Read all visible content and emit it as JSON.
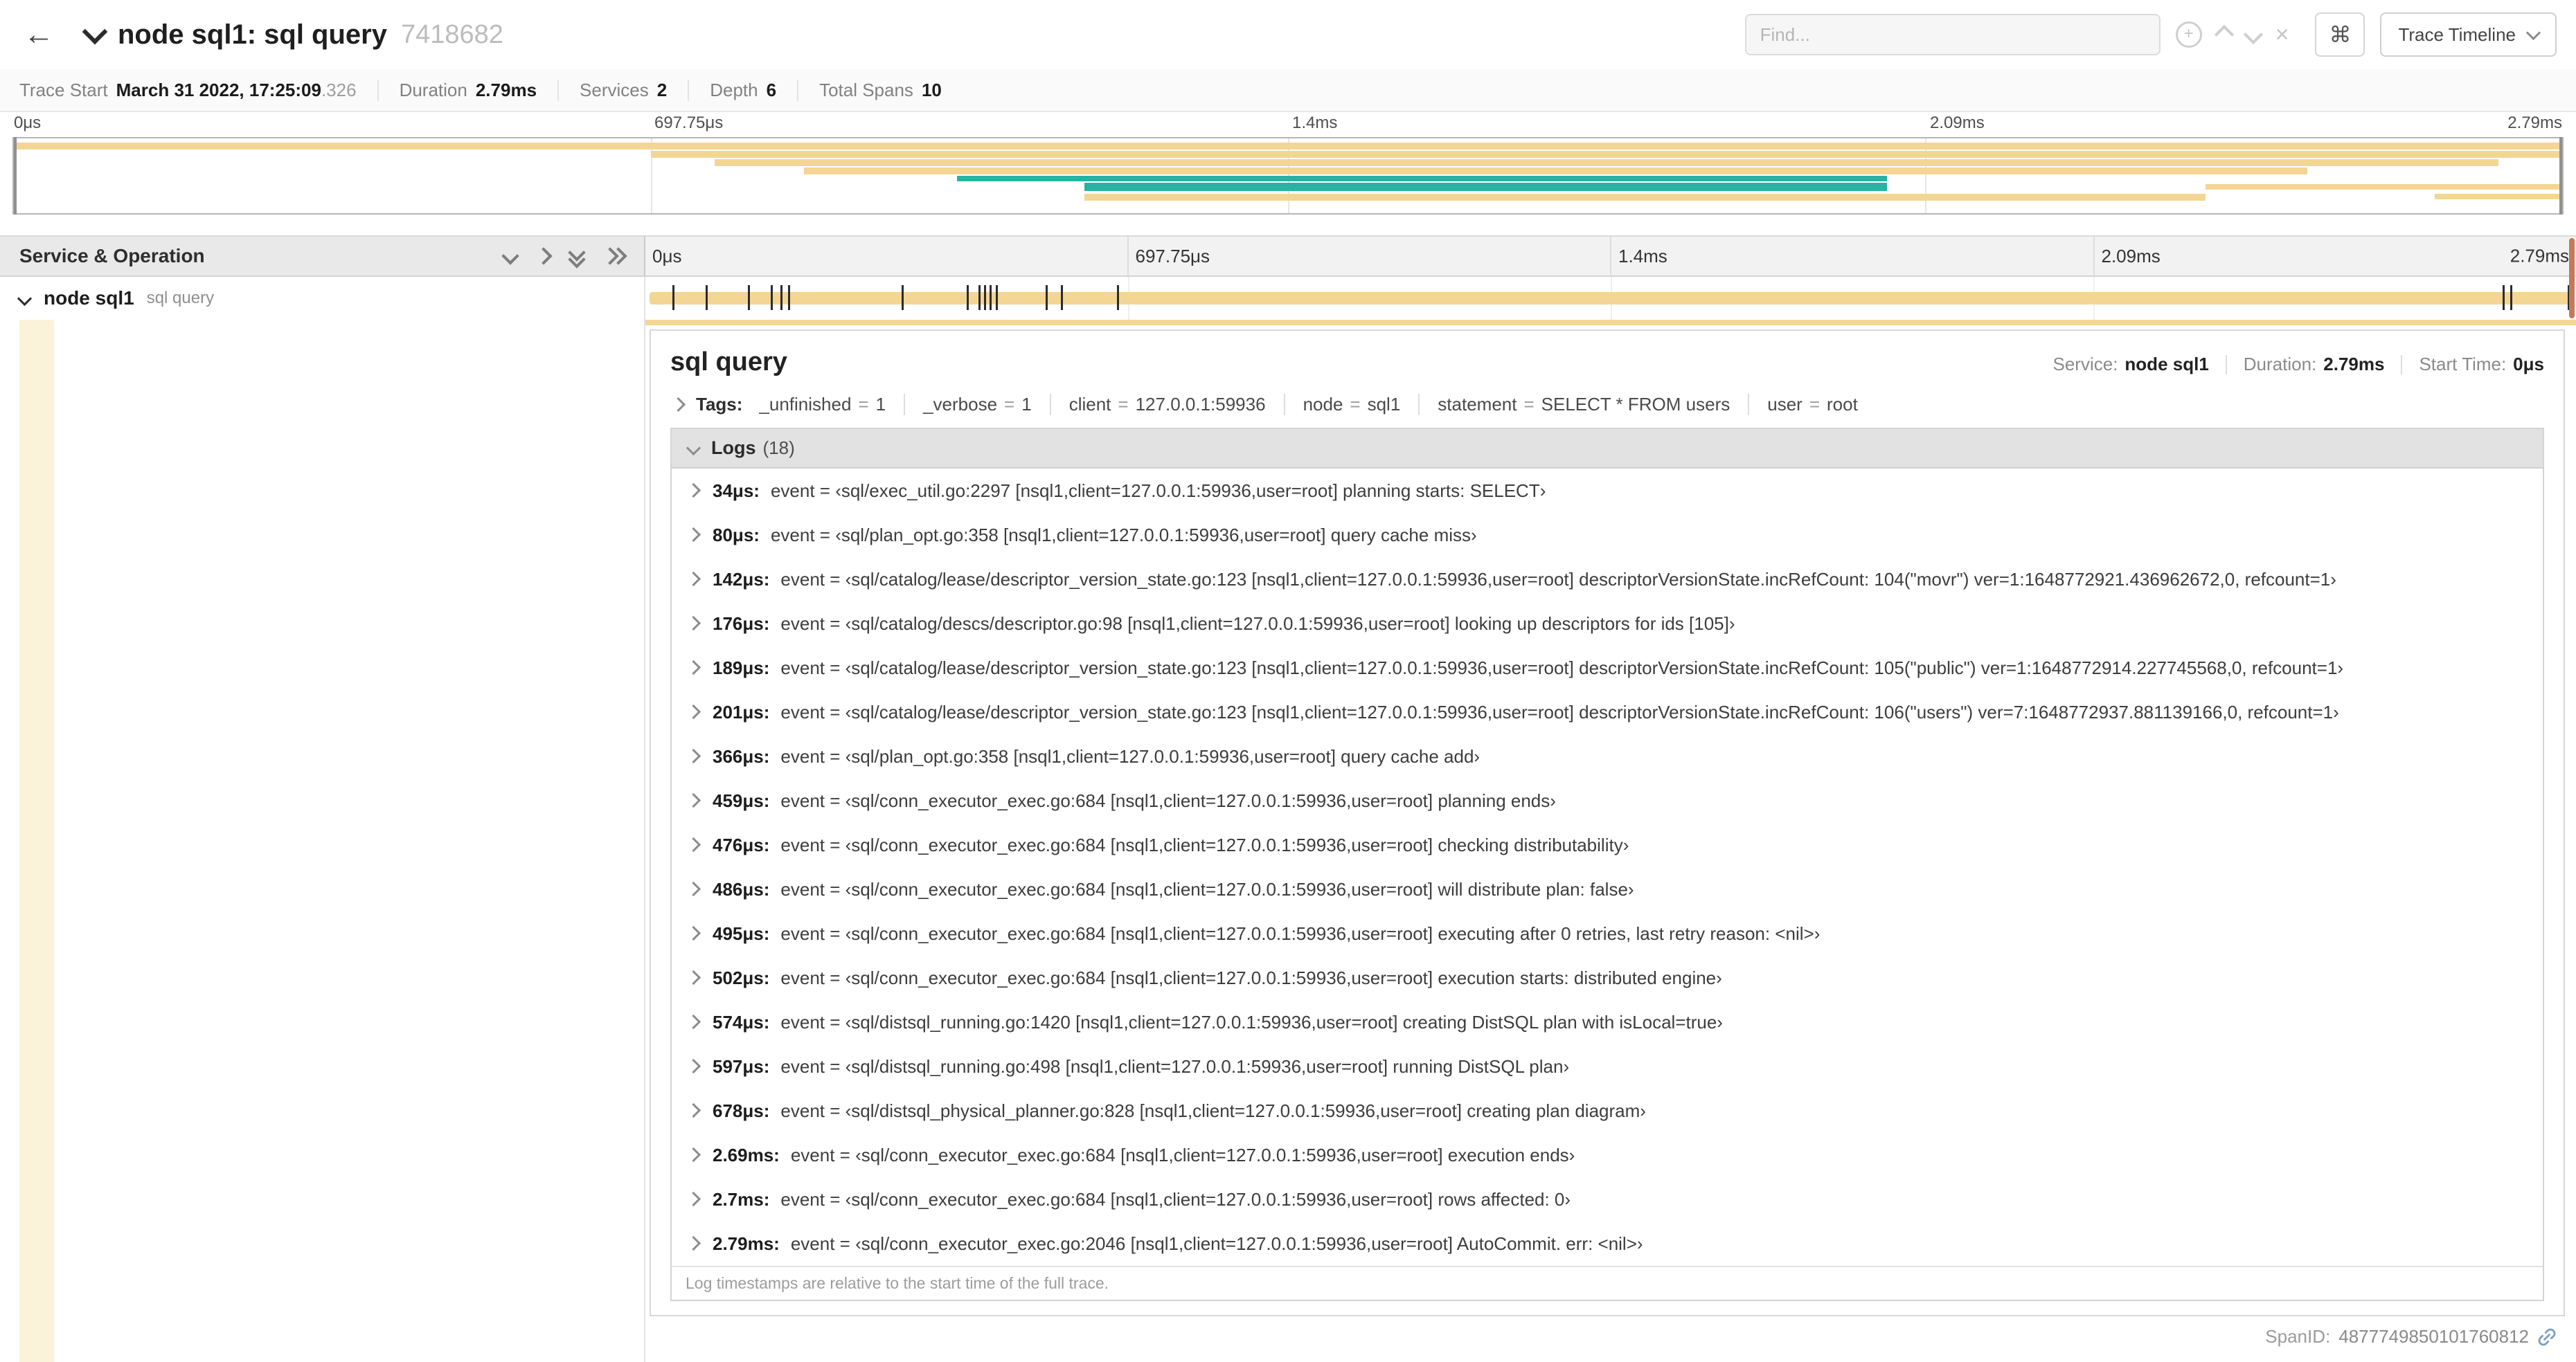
{
  "icons": {
    "back": "←",
    "command": "⌘",
    "clear": "×",
    "plus": "+"
  },
  "colors": {
    "tan": "#f3d694",
    "teal": "#26b3a4",
    "cream": "#fbf2da",
    "tick": "#2b2b2b"
  },
  "header": {
    "title": "node sql1: sql query",
    "trace_id": "7418682",
    "find_placeholder": "Find...",
    "view_button": "Trace Timeline"
  },
  "summary": {
    "items": [
      {
        "label": "Trace Start",
        "value": "March 31 2022, 17:25:09",
        "extra": ".326"
      },
      {
        "label": "Duration",
        "value": "2.79ms"
      },
      {
        "label": "Services",
        "value": "2"
      },
      {
        "label": "Depth",
        "value": "6"
      },
      {
        "label": "Total Spans",
        "value": "10"
      }
    ]
  },
  "axis": {
    "ticks": [
      "0μs",
      "697.75μs",
      "1.4ms",
      "2.09ms",
      "2.79ms"
    ]
  },
  "minimap": {
    "bars": [
      {
        "l": 0,
        "w": 100,
        "t": 3,
        "h": 5,
        "c": "tan"
      },
      {
        "l": 25,
        "w": 75,
        "t": 9,
        "h": 5,
        "c": "tan"
      },
      {
        "l": 27.5,
        "w": 70,
        "t": 15,
        "h": 5,
        "c": "tan"
      },
      {
        "l": 31,
        "w": 59,
        "t": 21,
        "h": 5,
        "c": "tan"
      },
      {
        "l": 37,
        "w": 36.5,
        "t": 27,
        "h": 4,
        "c": "teal"
      },
      {
        "l": 42,
        "w": 31.5,
        "t": 32,
        "h": 6,
        "c": "teal"
      },
      {
        "l": 42,
        "w": 44,
        "t": 40,
        "h": 5,
        "c": "tan"
      },
      {
        "l": 86,
        "w": 14,
        "t": 33,
        "h": 4,
        "c": "tan"
      },
      {
        "l": 95,
        "w": 5,
        "t": 40,
        "h": 4,
        "c": "tan"
      }
    ]
  },
  "timeline": {
    "left_header": "Service & Operation",
    "span": {
      "service": "node sql1",
      "operation": "sql query",
      "tick_percents": [
        1.2,
        2.9,
        5.1,
        6.3,
        6.8,
        7.2,
        13.1,
        16.5,
        17.1,
        17.4,
        17.7,
        18.0,
        20.6,
        21.4,
        24.3,
        96.4,
        96.8,
        99.8
      ]
    }
  },
  "detail": {
    "title": "sql query",
    "service_label": "Service:",
    "service": "node sql1",
    "duration_label": "Duration:",
    "duration": "2.79ms",
    "start_label": "Start Time:",
    "start": "0μs",
    "tags_label": "Tags:",
    "tags_eq": "=",
    "tags": [
      {
        "k": "_unfinished",
        "v": "1"
      },
      {
        "k": "_verbose",
        "v": "1"
      },
      {
        "k": "client",
        "v": "127.0.0.1:59936"
      },
      {
        "k": "node",
        "v": "sql1"
      },
      {
        "k": "statement",
        "v": "SELECT * FROM users"
      },
      {
        "k": "user",
        "v": "root"
      }
    ],
    "logs_label": "Logs",
    "logs_count": "(18)",
    "logs": [
      {
        "t": "34μs:",
        "msg": "event = ‹sql/exec_util.go:2297 [nsql1,client=127.0.0.1:59936,user=root] planning starts: SELECT›"
      },
      {
        "t": "80μs:",
        "msg": "event = ‹sql/plan_opt.go:358 [nsql1,client=127.0.0.1:59936,user=root] query cache miss›"
      },
      {
        "t": "142μs:",
        "msg": "event = ‹sql/catalog/lease/descriptor_version_state.go:123 [nsql1,client=127.0.0.1:59936,user=root] descriptorVersionState.incRefCount: 104(\"movr\") ver=1:1648772921.436962672,0, refcount=1›"
      },
      {
        "t": "176μs:",
        "msg": "event = ‹sql/catalog/descs/descriptor.go:98 [nsql1,client=127.0.0.1:59936,user=root] looking up descriptors for ids [105]›"
      },
      {
        "t": "189μs:",
        "msg": "event = ‹sql/catalog/lease/descriptor_version_state.go:123 [nsql1,client=127.0.0.1:59936,user=root] descriptorVersionState.incRefCount: 105(\"public\") ver=1:1648772914.227745568,0, refcount=1›"
      },
      {
        "t": "201μs:",
        "msg": "event = ‹sql/catalog/lease/descriptor_version_state.go:123 [nsql1,client=127.0.0.1:59936,user=root] descriptorVersionState.incRefCount: 106(\"users\") ver=7:1648772937.881139166,0, refcount=1›"
      },
      {
        "t": "366μs:",
        "msg": "event = ‹sql/plan_opt.go:358 [nsql1,client=127.0.0.1:59936,user=root] query cache add›"
      },
      {
        "t": "459μs:",
        "msg": "event = ‹sql/conn_executor_exec.go:684 [nsql1,client=127.0.0.1:59936,user=root] planning ends›"
      },
      {
        "t": "476μs:",
        "msg": "event = ‹sql/conn_executor_exec.go:684 [nsql1,client=127.0.0.1:59936,user=root] checking distributability›"
      },
      {
        "t": "486μs:",
        "msg": "event = ‹sql/conn_executor_exec.go:684 [nsql1,client=127.0.0.1:59936,user=root] will distribute plan: false›"
      },
      {
        "t": "495μs:",
        "msg": "event = ‹sql/conn_executor_exec.go:684 [nsql1,client=127.0.0.1:59936,user=root] executing after 0 retries, last retry reason: <nil>›"
      },
      {
        "t": "502μs:",
        "msg": "event = ‹sql/conn_executor_exec.go:684 [nsql1,client=127.0.0.1:59936,user=root] execution starts: distributed engine›"
      },
      {
        "t": "574μs:",
        "msg": "event = ‹sql/distsql_running.go:1420 [nsql1,client=127.0.0.1:59936,user=root] creating DistSQL plan with isLocal=true›"
      },
      {
        "t": "597μs:",
        "msg": "event = ‹sql/distsql_running.go:498 [nsql1,client=127.0.0.1:59936,user=root] running DistSQL plan›"
      },
      {
        "t": "678μs:",
        "msg": "event = ‹sql/distsql_physical_planner.go:828 [nsql1,client=127.0.0.1:59936,user=root] creating plan diagram›"
      },
      {
        "t": "2.69ms:",
        "msg": "event = ‹sql/conn_executor_exec.go:684 [nsql1,client=127.0.0.1:59936,user=root] execution ends›"
      },
      {
        "t": "2.7ms:",
        "msg": "event = ‹sql/conn_executor_exec.go:684 [nsql1,client=127.0.0.1:59936,user=root] rows affected: 0›"
      },
      {
        "t": "2.79ms:",
        "msg": "event = ‹sql/conn_executor_exec.go:2046 [nsql1,client=127.0.0.1:59936,user=root] AutoCommit. err: <nil>›"
      }
    ],
    "footer_note": "Log timestamps are relative to the start time of the full trace.",
    "span_id_label": "SpanID:",
    "span_id": "4877749850101760812"
  }
}
